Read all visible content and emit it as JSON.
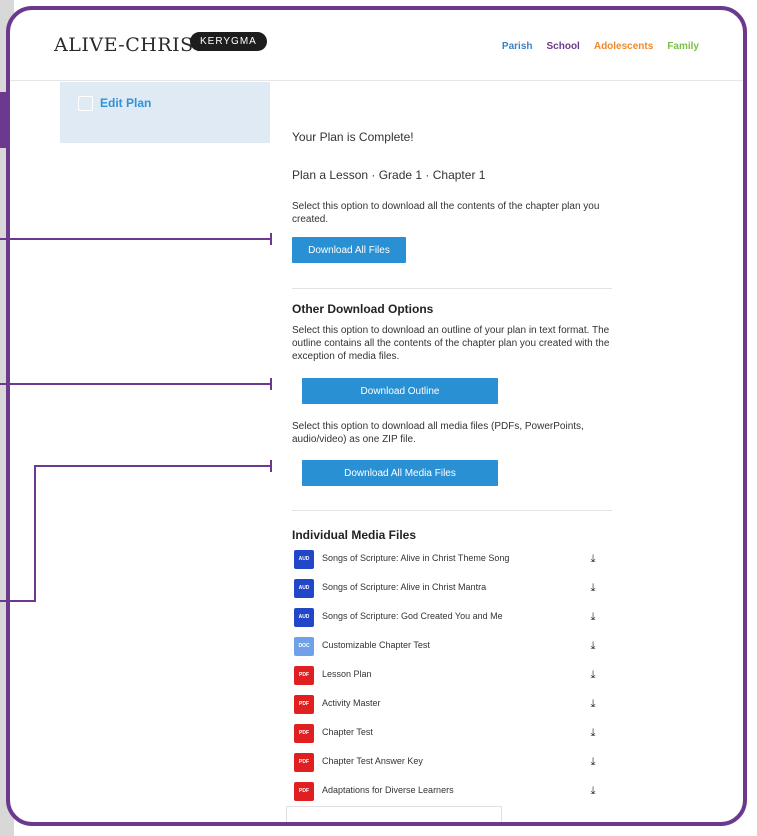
{
  "brand": {
    "logo": "ALIVE-CHRIST",
    "badge": "KERYGMA"
  },
  "nav": [
    {
      "label": "Parish",
      "color": "#3b82c4"
    },
    {
      "label": "School",
      "color": "#6b3a8e"
    },
    {
      "label": "Adolescents",
      "color": "#f0892b"
    },
    {
      "label": "Family",
      "color": "#7cbf45"
    }
  ],
  "sidebar": {
    "item_label": "Edit Plan"
  },
  "main": {
    "complete_title": "Your Plan is Complete!",
    "plan_subtitle": "Plan a Lesson · Grade 1 · Chapter 1",
    "download_all_desc": "Select this option to download all the contents of the chapter plan you created.",
    "download_all_label": "Download All Files",
    "other_options_title": "Other Download Options",
    "outline_desc": "Select this option to download an outline of your plan in text format. The outline contains all the contents of the chapter plan you created with the exception of media files.",
    "outline_label": "Download Outline",
    "media_desc": "Select this option to download all media files (PDFs, PowerPoints, audio/video) as one ZIP file.",
    "media_label": "Download All Media Files",
    "individual_title": "Individual Media Files"
  },
  "files": [
    {
      "type": "AUD",
      "color": "#2146c7",
      "name": "Songs of Scripture: Alive in Christ Theme Song"
    },
    {
      "type": "AUD",
      "color": "#2146c7",
      "name": "Songs of Scripture: Alive in Christ Mantra"
    },
    {
      "type": "AUD",
      "color": "#2146c7",
      "name": "Songs of Scripture: God Created You and Me"
    },
    {
      "type": "DOC",
      "color": "#6fa0e8",
      "name": "Customizable Chapter Test"
    },
    {
      "type": "PDF",
      "color": "#e02020",
      "name": "Lesson Plan"
    },
    {
      "type": "PDF",
      "color": "#e02020",
      "name": "Activity Master"
    },
    {
      "type": "PDF",
      "color": "#e02020",
      "name": "Chapter Test"
    },
    {
      "type": "PDF",
      "color": "#e02020",
      "name": "Chapter Test Answer Key"
    },
    {
      "type": "PDF",
      "color": "#e02020",
      "name": "Adaptations for Diverse Learners"
    }
  ],
  "icons": {
    "download": "download-icon"
  }
}
